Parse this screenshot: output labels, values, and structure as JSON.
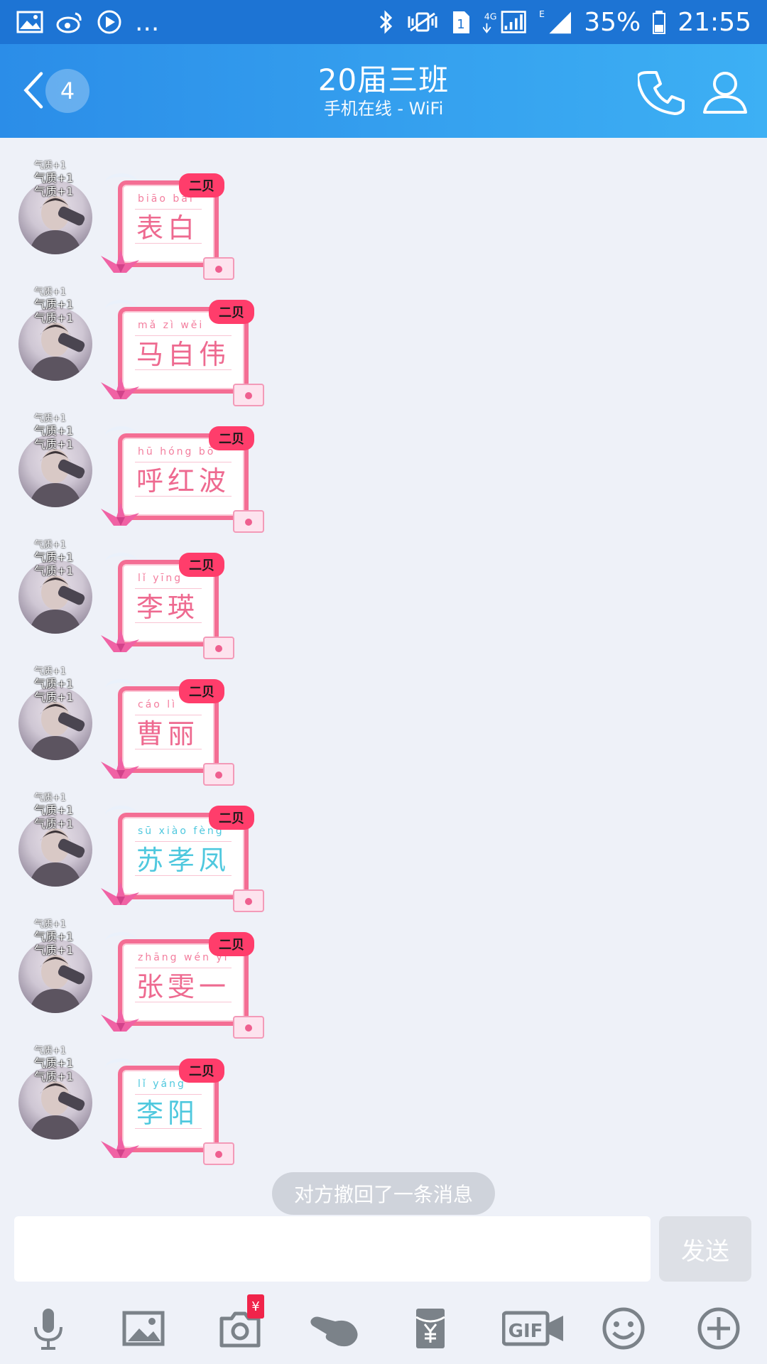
{
  "status_bar": {
    "more": "...",
    "battery": "35%",
    "time": "21:55",
    "sim": "1",
    "net": "4G",
    "edge": "E"
  },
  "header": {
    "title": "20届三班",
    "subtitle": "手机在线 - WiFi",
    "unread_count": "4"
  },
  "messages": [
    {
      "pinyin": "biāo bái",
      "hanzi": "表白",
      "badge": "二贝",
      "blue": false
    },
    {
      "pinyin": "mǎ zì wěi",
      "hanzi": "马自伟",
      "badge": "二贝",
      "blue": false
    },
    {
      "pinyin": "hū hóng bō",
      "hanzi": "呼红波",
      "badge": "二贝",
      "blue": false
    },
    {
      "pinyin": "lǐ yīng",
      "hanzi": "李瑛",
      "badge": "二贝",
      "blue": false
    },
    {
      "pinyin": "cáo lì",
      "hanzi": "曹丽",
      "badge": "二贝",
      "blue": false
    },
    {
      "pinyin": "sū xiào fèng",
      "hanzi": "苏孝凤",
      "badge": "二贝",
      "blue": true
    },
    {
      "pinyin": "zhāng wén yī",
      "hanzi": "张雯一",
      "badge": "二贝",
      "blue": false
    },
    {
      "pinyin": "lǐ yáng",
      "hanzi": "李阳",
      "badge": "二贝",
      "blue": true
    }
  ],
  "avatar_tag": {
    "faint": "气质+1",
    "line1": "气质+1",
    "line2": "气质+1"
  },
  "recall_notice": "对方撤回了一条消息",
  "composer": {
    "value": "",
    "send_label": "发送"
  },
  "toolbar": {
    "items": [
      "microphone-icon",
      "image-icon",
      "camera-icon",
      "poke-icon",
      "red-packet-icon",
      "gif-icon",
      "emoji-icon",
      "plus-icon"
    ],
    "camera_badge": "¥"
  },
  "colors": {
    "header_start": "#2b8de8",
    "header_end": "#3db0f4",
    "status_bg": "#1d74d4",
    "card_border": "#f46e94",
    "chat_bg": "#eef1f8"
  }
}
